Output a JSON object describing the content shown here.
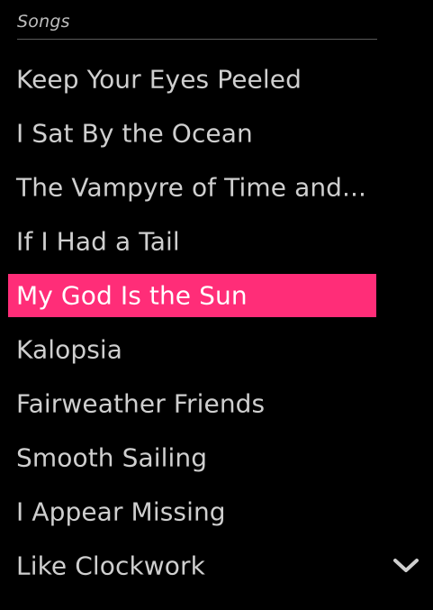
{
  "section": {
    "title": "Songs"
  },
  "songs": [
    {
      "title": "Keep Your Eyes Peeled"
    },
    {
      "title": "I Sat By the Ocean"
    },
    {
      "title": "The Vampyre of Time and..."
    },
    {
      "title": "If I Had a Tail"
    },
    {
      "title": "My God Is the Sun"
    },
    {
      "title": "Kalopsia"
    },
    {
      "title": "Fairweather Friends"
    },
    {
      "title": "Smooth Sailing"
    },
    {
      "title": "I Appear Missing"
    },
    {
      "title": "Like Clockwork"
    }
  ],
  "selected_index": 4,
  "colors": {
    "background": "#000000",
    "highlight": "#ff2d78",
    "text": "#cfcfcf",
    "selected_text": "#ffffff"
  },
  "icons": {
    "scroll": "chevron-down-icon"
  }
}
